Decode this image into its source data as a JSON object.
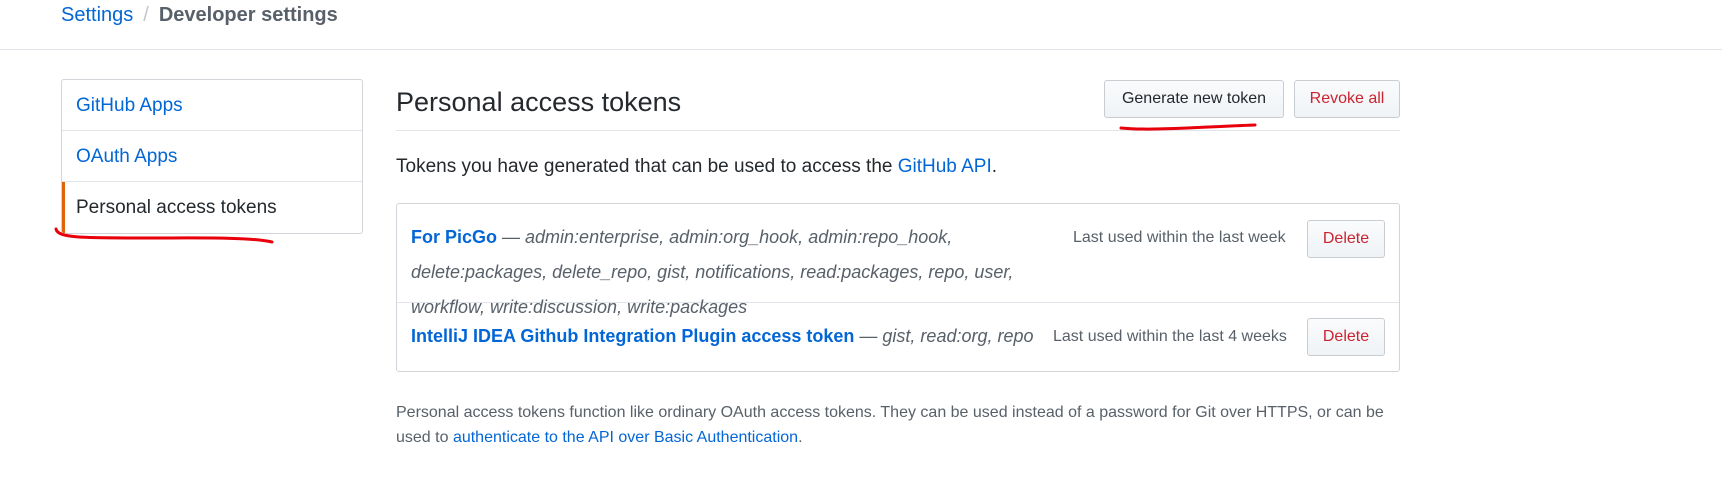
{
  "breadcrumb": {
    "settings": "Settings",
    "separator": "/",
    "current": "Developer settings"
  },
  "sidebar": {
    "items": [
      {
        "label": "GitHub Apps",
        "active": false
      },
      {
        "label": "OAuth Apps",
        "active": false
      },
      {
        "label": "Personal access tokens",
        "active": true
      }
    ]
  },
  "main": {
    "title": "Personal access tokens",
    "generate_label": "Generate new token",
    "revoke_label": "Revoke all",
    "description_prefix": "Tokens you have generated that can be used to access the ",
    "description_link": "GitHub API",
    "description_suffix": "."
  },
  "tokens": [
    {
      "name": "For PicGo",
      "separator": " — ",
      "scopes": "admin:enterprise, admin:org_hook, admin:repo_hook, delete:packages, delete_repo, gist, notifications, read:packages, repo, user, workflow, write:discussion, write:packages",
      "last_used": "Last used within the last week",
      "delete_label": "Delete"
    },
    {
      "name": "IntelliJ IDEA Github Integration Plugin access token",
      "separator": " — ",
      "scopes": "gist, read:org, repo",
      "last_used": "Last used within the last 4 weeks",
      "delete_label": "Delete"
    }
  ],
  "footnote": {
    "text": "Personal access tokens function like ordinary OAuth access tokens. They can be used instead of a password for Git over HTTPS, or can be used to ",
    "link": "authenticate to the API over Basic Authentication",
    "suffix": "."
  },
  "colors": {
    "link": "#0366d6",
    "danger": "#cb2431",
    "active_indicator": "#e36209",
    "annotation": "#e8000b"
  }
}
